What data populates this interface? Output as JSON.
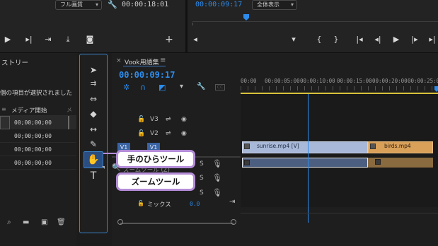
{
  "top": {
    "quality_left": "フル画質",
    "timecode_left": "00:00:18:01",
    "timecode_right": "00:00:09:17",
    "zoom_right": "全体表示"
  },
  "history": {
    "title": "ストリー",
    "message": "個の項目が選択されました",
    "column": "メディア開始",
    "rows": [
      "00;00;00;00",
      "00;00;00;00",
      "00;00;00;00",
      "00;00;00;00"
    ]
  },
  "timeline": {
    "tab_title": "Vook用語集",
    "playhead_timecode": "00:00:09:17",
    "ruler_labels": [
      "00:00",
      "00:00:05:00",
      "00:00:10:00",
      "00:00:15:00",
      "00:00:20:00",
      "00:00:25:00"
    ],
    "tracks": {
      "v3": "V3",
      "v2": "V2",
      "v1_src": "V1",
      "v1": "V1",
      "mix_label": "ミックス",
      "mix_value": "0.0"
    },
    "clips": {
      "clip1": "sunrise.mp4 [V]",
      "clip2": "birds.mp4"
    },
    "tooltip_faded": "ズームツール (Z)"
  },
  "callouts": {
    "hand_tool": "手のひらツール",
    "zoom_tool": "ズームツール"
  },
  "colors": {
    "accent_blue": "#2d8ceb",
    "clip_blue": "#a8b8d8",
    "clip_gold": "#d9a05a",
    "callout_border": "#b48cd8"
  }
}
